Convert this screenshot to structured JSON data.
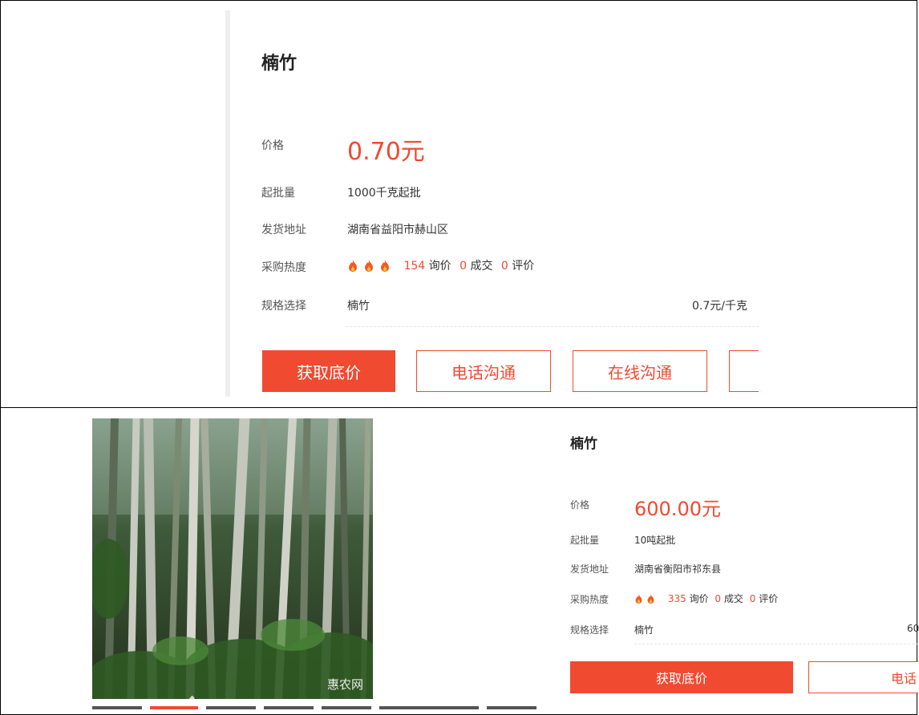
{
  "panel_top": {
    "product_title": "楠竹",
    "price_label": "价格",
    "price_value": "0.70元",
    "min_order_label": "起批量",
    "min_order_value": "1000千克起批",
    "ship_from_label": "发货地址",
    "ship_from_value": "湖南省益阳市赫山区",
    "heat_label": "采购热度",
    "heat_inquiries": "154",
    "heat_inquiries_label": "询价",
    "heat_deals": "0",
    "heat_deals_label": "成交",
    "heat_reviews": "0",
    "heat_reviews_label": "评价",
    "spec_label": "规格选择",
    "spec_value": "楠竹",
    "spec_price": "0.7元/千克",
    "btn_lowest_price": "获取底价",
    "btn_phone": "电话沟通",
    "btn_online": "在线沟通"
  },
  "panel_bottom": {
    "product_title": "楠竹",
    "price_label": "价格",
    "price_value": "600.00元",
    "min_order_label": "起批量",
    "min_order_value": "10吨起批",
    "ship_from_label": "发货地址",
    "ship_from_value": "湖南省衡阳市祁东县",
    "heat_label": "采购热度",
    "heat_inquiries": "335",
    "heat_inquiries_label": "询价",
    "heat_deals": "0",
    "heat_deals_label": "成交",
    "heat_reviews": "0",
    "heat_reviews_label": "评价",
    "spec_label": "规格选择",
    "spec_value": "楠竹",
    "spec_price": "60",
    "btn_lowest_price": "获取底价",
    "btn_phone": "电话",
    "watermark": "惠农网"
  },
  "colors": {
    "accent": "#f04a30"
  },
  "icons": [
    "fire-icon"
  ]
}
